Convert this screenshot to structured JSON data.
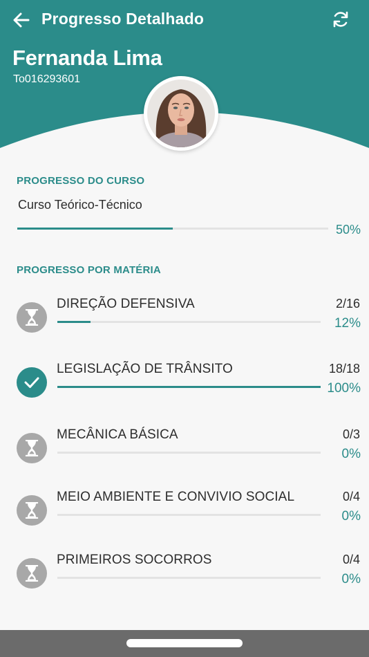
{
  "header": {
    "title": "Progresso Detalhado",
    "back_icon": "arrow-left-icon",
    "refresh_icon": "refresh-icon",
    "color": "#2b8c8a"
  },
  "student": {
    "name": "Fernanda Lima",
    "id": "To016293601",
    "avatar": "profile-photo"
  },
  "course_section": {
    "title": "PROGRESSO DO CURSO",
    "course_name": "Curso Teórico-Técnico",
    "progress": 0.5,
    "percent_label": "50%"
  },
  "subjects_section": {
    "title": "PROGRESSO POR MATÉRIA",
    "items": [
      {
        "name": "DIREÇÃO DEFENSIVA",
        "count": "2/16",
        "percent": "12%",
        "progress": 0.125,
        "status": "pending",
        "icon": "hourglass-icon"
      },
      {
        "name": "LEGISLAÇÃO DE TRÂNSITO",
        "count": "18/18",
        "percent": "100%",
        "progress": 1.0,
        "status": "done",
        "icon": "check-icon"
      },
      {
        "name": "MECÂNICA BÁSICA",
        "count": "0/3",
        "percent": "0%",
        "progress": 0,
        "status": "pending",
        "icon": "hourglass-icon"
      },
      {
        "name": "MEIO AMBIENTE E CONVIVIO SOCIAL",
        "count": "0/4",
        "percent": "0%",
        "progress": 0,
        "status": "pending",
        "icon": "hourglass-icon"
      },
      {
        "name": "PRIMEIROS SOCORROS",
        "count": "0/4",
        "percent": "0%",
        "progress": 0,
        "status": "pending",
        "icon": "hourglass-icon"
      }
    ]
  },
  "colors": {
    "accent": "#2b8c8a",
    "pending": "#a8a8a8",
    "track": "#e3e3e3"
  }
}
